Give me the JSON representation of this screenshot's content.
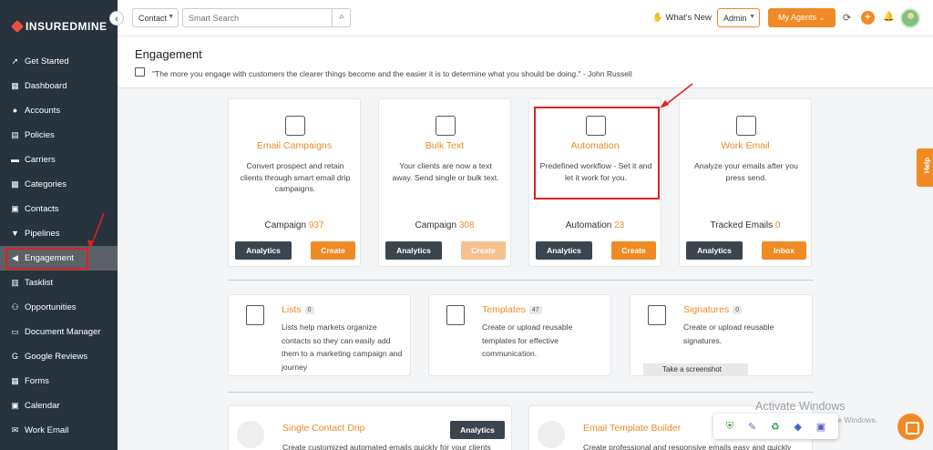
{
  "app": {
    "brand": "INSUREDMINE"
  },
  "sidebar": {
    "collapse_glyph": "‹",
    "items": [
      {
        "label": "Get Started",
        "icon": "rocket-icon"
      },
      {
        "label": "Dashboard",
        "icon": "dashboard-icon"
      },
      {
        "label": "Accounts",
        "icon": "users-icon"
      },
      {
        "label": "Policies",
        "icon": "document-icon"
      },
      {
        "label": "Carriers",
        "icon": "truck-icon"
      },
      {
        "label": "Categories",
        "icon": "categories-icon"
      },
      {
        "label": "Contacts",
        "icon": "contacts-icon"
      },
      {
        "label": "Pipelines",
        "icon": "filter-icon"
      },
      {
        "label": "Engagement",
        "icon": "megaphone-icon",
        "active": true
      },
      {
        "label": "Tasklist",
        "icon": "tasklist-icon"
      },
      {
        "label": "Opportunities",
        "icon": "opportunities-icon"
      },
      {
        "label": "Document Manager",
        "icon": "folder-icon"
      },
      {
        "label": "Google Reviews",
        "icon": "google-icon"
      },
      {
        "label": "Forms",
        "icon": "forms-icon"
      },
      {
        "label": "Calendar",
        "icon": "calendar-icon"
      },
      {
        "label": "Work Email",
        "icon": "mail-icon"
      }
    ]
  },
  "topbar": {
    "entity_select": "Contact",
    "search_placeholder": "Smart Search",
    "whats_new": "What's New",
    "role_select": "Admin",
    "agents_button": "My Agents"
  },
  "header": {
    "title": "Engagement",
    "quote": "\"The more you engage with customers the clearer things become and the easier it is to determine what you should be doing.\" - John Russell"
  },
  "cards": [
    {
      "title": "Email Campaigns",
      "desc": "Convert prospect and retain clients through smart email drip campaigns.",
      "stat_label": "Campaign",
      "stat_value": "937",
      "btn1": "Analytics",
      "btn2": "Create",
      "icon": "email-campaign-icon"
    },
    {
      "title": "Bulk Text",
      "desc": "Your clients are now a text away. Send single or bulk text.",
      "stat_label": "Campaign",
      "stat_value": "308",
      "btn1": "Analytics",
      "btn2": "Create",
      "btn2_disabled": true,
      "icon": "chat-bubble-icon"
    },
    {
      "title": "Automation",
      "desc": "Predefined workflow - Set it and let it work for you.",
      "stat_label": "Automation",
      "stat_value": "23",
      "btn1": "Analytics",
      "btn2": "Create",
      "icon": "workflow-icon"
    },
    {
      "title": "Work Email",
      "desc": "Analyze your emails after you press send.",
      "stat_label": "Tracked Emails",
      "stat_value": "0",
      "btn1": "Analytics",
      "btn2": "Inbox",
      "icon": "work-email-icon"
    }
  ],
  "features": [
    {
      "title": "Lists",
      "badge": "0",
      "desc": "Lists help markets organize contacts so they can easily add them to a marketing campaign and journey",
      "icon": "checklist-icon"
    },
    {
      "title": "Templates",
      "badge": "47",
      "desc": "Create or upload reusable templates for effective communication.",
      "icon": "template-icon"
    },
    {
      "title": "Signatures",
      "badge": "0",
      "desc": "Create or upload reusable signatures.",
      "icon": "signature-icon"
    }
  ],
  "tooltip": "Take a screenshot",
  "bottom": [
    {
      "title": "Single Contact Drip",
      "desc": "Create customized automated emails quickly for your clients",
      "button": "Analytics"
    },
    {
      "title": "Email Template Builder",
      "desc": "Create professional and responsive emails easy and quickly"
    }
  ],
  "help_tab": "Help",
  "watermark": {
    "line1": "Activate Windows",
    "line2": "Go to Settings to activate Windows."
  }
}
